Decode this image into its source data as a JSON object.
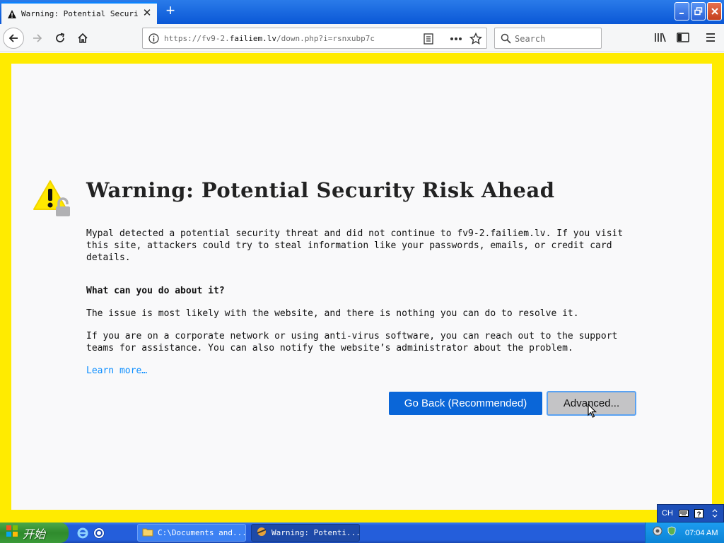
{
  "tab": {
    "title": "Warning: Potential Security Risk Ahead",
    "close": "✕"
  },
  "newtab": "+",
  "navbar": {
    "url_prefix": "https://fv9-2.",
    "url_domain": "failiem.lv",
    "url_path": "/down.php?i=rsnxubp7c",
    "search_placeholder": "Search"
  },
  "page": {
    "headline": "Warning: Potential Security Risk Ahead",
    "intro": "Mypal detected a potential security threat and did not continue to fv9-2.failiem.lv. If you visit this site, attackers could try to steal information like your passwords, emails, or credit card details.",
    "subhead": "What can you do about it?",
    "p2": "The issue is most likely with the website, and there is nothing you can do to resolve it.",
    "p3": "If you are on a corporate network or using anti-virus software, you can reach out to the support teams for assistance. You can also notify the website’s administrator about the problem.",
    "learn_more": "Learn more…",
    "go_back": "Go Back (Recommended)",
    "advanced": "Advanced..."
  },
  "langbar": {
    "lang": "CH"
  },
  "taskbar": {
    "start": "开始",
    "tasks": [
      {
        "label": "C:\\Documents and..."
      },
      {
        "label": "Warning: Potenti..."
      }
    ],
    "clock": "07:04 AM"
  },
  "colors": {
    "frame": "#ffeb00",
    "primary_button": "#0a66d8",
    "link": "#0a8dff"
  }
}
